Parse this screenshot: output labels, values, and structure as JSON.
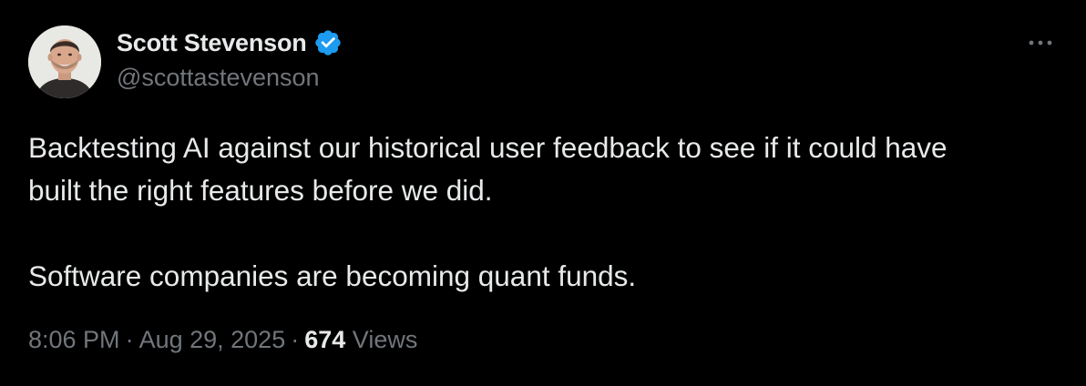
{
  "author": {
    "display_name": "Scott Stevenson",
    "handle": "@scottastevenson",
    "verified": true,
    "avatar_icon": "profile-photo"
  },
  "tweet": {
    "lines_paragraph_1": [
      "Backtesting AI against our historical user feedback to see if it could have",
      "built the right features before we did."
    ],
    "paragraph_2": "Software companies are becoming quant funds."
  },
  "meta": {
    "time": "8:06 PM",
    "date": "Aug 29, 2025",
    "separator": "·",
    "view_count": "674",
    "views_label": "Views"
  },
  "icons": {
    "verified": "verified-badge-icon",
    "more": "more-options-icon"
  },
  "colors": {
    "background": "#000000",
    "primary_text": "#e7e9ea",
    "secondary_text": "#71767b",
    "verified_blue": "#1d9bf0"
  }
}
